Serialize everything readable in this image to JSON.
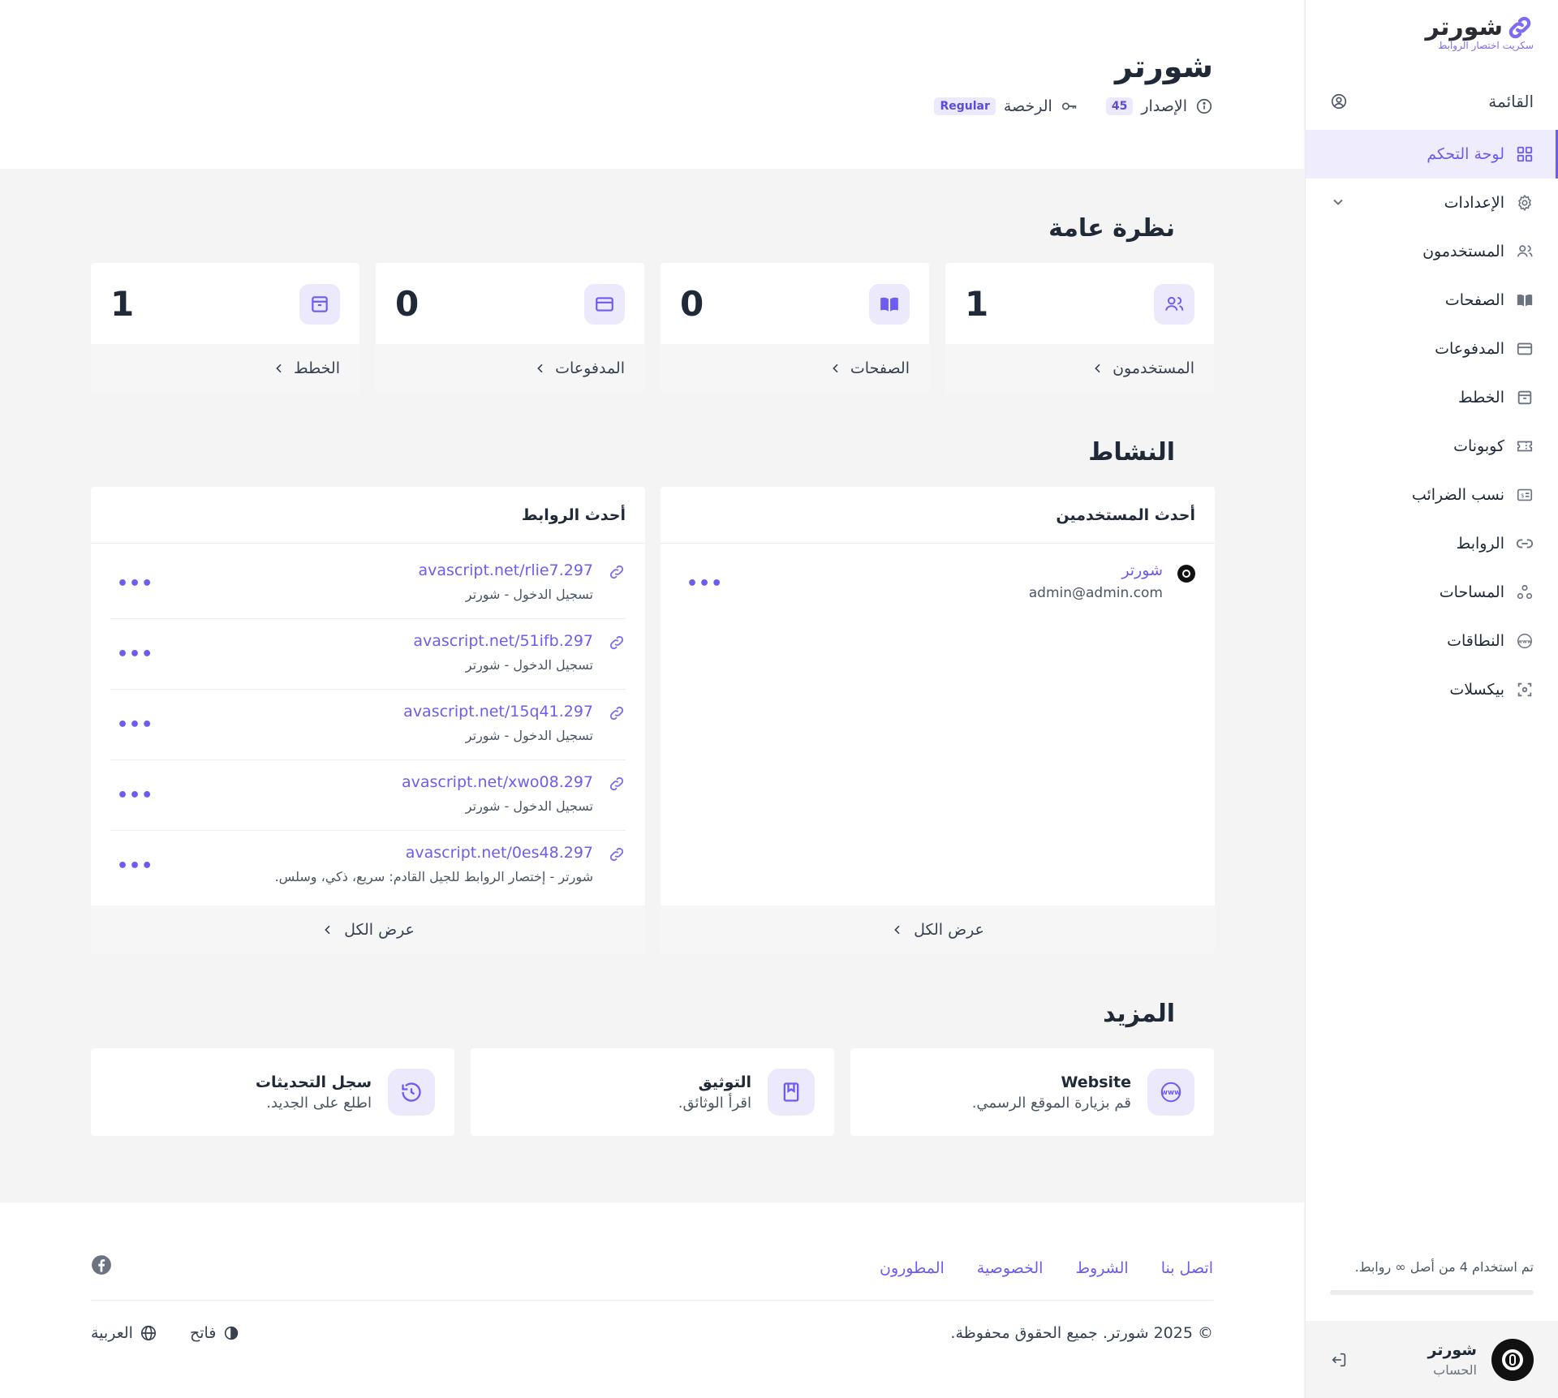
{
  "brand": {
    "name": "شورتر",
    "tagline": "سكريت اختصار الروابط"
  },
  "sidebar": {
    "menu_label": "القائمة",
    "items": [
      {
        "label": "لوحة التحكم",
        "icon": "grid-icon",
        "active": true
      },
      {
        "label": "الإعدادات",
        "icon": "gear-icon",
        "expandable": true
      },
      {
        "label": "المستخدمون",
        "icon": "users-icon"
      },
      {
        "label": "الصفحات",
        "icon": "book-icon"
      },
      {
        "label": "المدفوعات",
        "icon": "credit-card-icon"
      },
      {
        "label": "الخطط",
        "icon": "archive-icon"
      },
      {
        "label": "كوبونات",
        "icon": "ticket-icon"
      },
      {
        "label": "نسب الضرائب",
        "icon": "receipt-icon"
      },
      {
        "label": "الروابط",
        "icon": "link-icon"
      },
      {
        "label": "المساحات",
        "icon": "spaces-icon"
      },
      {
        "label": "النطاقات",
        "icon": "www-icon"
      },
      {
        "label": "بيكسلات",
        "icon": "scan-icon"
      }
    ],
    "usage_text": "تم استخدام 4 من أصل ∞ روابط.",
    "account": {
      "name": "شورتر",
      "label": "الحساب"
    }
  },
  "header": {
    "title": "شورتر",
    "version_label": "الإصدار",
    "version": "45",
    "license_label": "الرخصة",
    "license": "Regular"
  },
  "overview": {
    "title": "نظرة عامة",
    "cards": [
      {
        "label": "المستخدمون",
        "value": "1",
        "icon": "users-icon"
      },
      {
        "label": "الصفحات",
        "value": "0",
        "icon": "book-icon"
      },
      {
        "label": "المدفوعات",
        "value": "0",
        "icon": "credit-card-icon"
      },
      {
        "label": "الخطط",
        "value": "1",
        "icon": "archive-icon"
      }
    ]
  },
  "activity": {
    "title": "النشاط",
    "users_panel": {
      "title": "أحدث المستخدمين",
      "users": [
        {
          "name": "شورتر",
          "email": "admin@admin.com"
        }
      ],
      "view_all": "عرض الكل"
    },
    "links_panel": {
      "title": "أحدث الروابط",
      "links": [
        {
          "url": "297.avascript.net/rlie7",
          "desc": "تسجيل الدخول - شورتر"
        },
        {
          "url": "297.avascript.net/51ifb",
          "desc": "تسجيل الدخول - شورتر"
        },
        {
          "url": "297.avascript.net/15q41",
          "desc": "تسجيل الدخول - شورتر"
        },
        {
          "url": "297.avascript.net/xwo08",
          "desc": "تسجيل الدخول - شورتر"
        },
        {
          "url": "297.avascript.net/0es48",
          "desc": "شورتر - إختصار الروابط للجيل القادم: سريع، ذكي، وسلس."
        }
      ],
      "view_all": "عرض الكل"
    }
  },
  "more": {
    "title": "المزيد",
    "cards": [
      {
        "title": "Website",
        "subtitle": "قم بزيارة الموقع الرسمي.",
        "icon": "www-icon"
      },
      {
        "title": "التوثيق",
        "subtitle": "اقرأ الوثائق.",
        "icon": "bookmark-icon"
      },
      {
        "title": "سجل التحديثات",
        "subtitle": "اطلع على الجديد.",
        "icon": "history-icon"
      }
    ]
  },
  "footer": {
    "links": [
      "اتصل بنا",
      "الشروط",
      "الخصوصية",
      "المطورون"
    ],
    "copyright": "© 2025 شورتر. جميع الحقوق محفوظة.",
    "theme": "فاتح",
    "language": "العربية"
  },
  "colors": {
    "accent": "#6d5cf2",
    "accent_bg": "#ece9fd",
    "page_bg": "#f4f4f4"
  }
}
